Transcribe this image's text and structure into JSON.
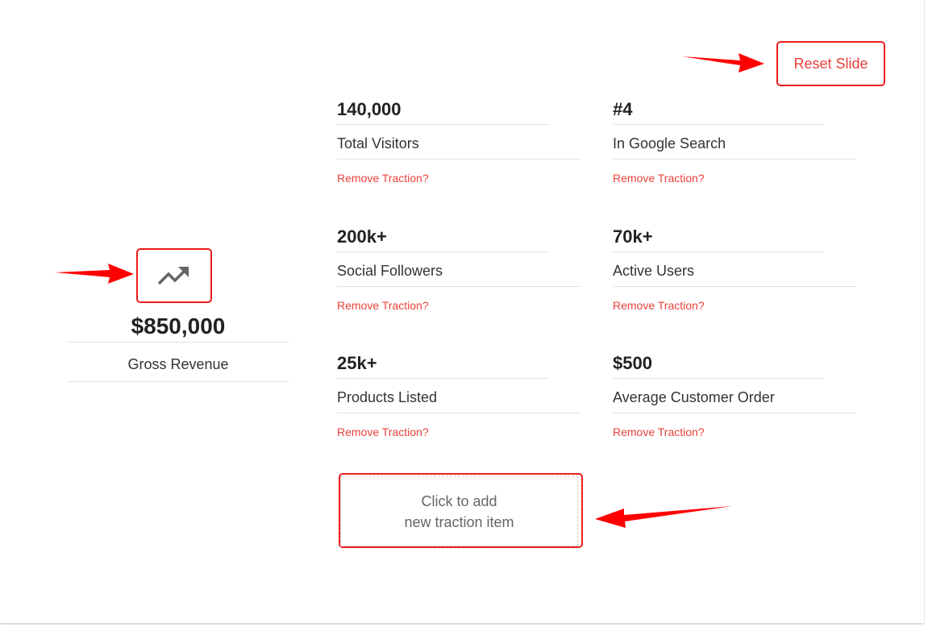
{
  "toolbar": {
    "reset_label": "Reset Slide"
  },
  "featured": {
    "icon": "trending-up-icon",
    "value": "$850,000",
    "label": "Gross Revenue"
  },
  "traction_items": [
    {
      "value": "140,000",
      "label": "Total Visitors",
      "remove_label": "Remove Traction?"
    },
    {
      "value": "#4",
      "label": "In Google Search",
      "remove_label": "Remove Traction?"
    },
    {
      "value": "200k+",
      "label": "Social Followers",
      "remove_label": "Remove Traction?"
    },
    {
      "value": "70k+",
      "label": "Active Users",
      "remove_label": "Remove Traction?"
    },
    {
      "value": "25k+",
      "label": "Products Listed",
      "remove_label": "Remove Traction?"
    },
    {
      "value": "$500",
      "label": "Average Customer Order",
      "remove_label": "Remove Traction?"
    }
  ],
  "add_item": {
    "line1": "Click to add",
    "line2": "new traction item"
  },
  "colors": {
    "accent": "#e8413a",
    "highlight": "#ee1c1c",
    "text": "#222222"
  }
}
